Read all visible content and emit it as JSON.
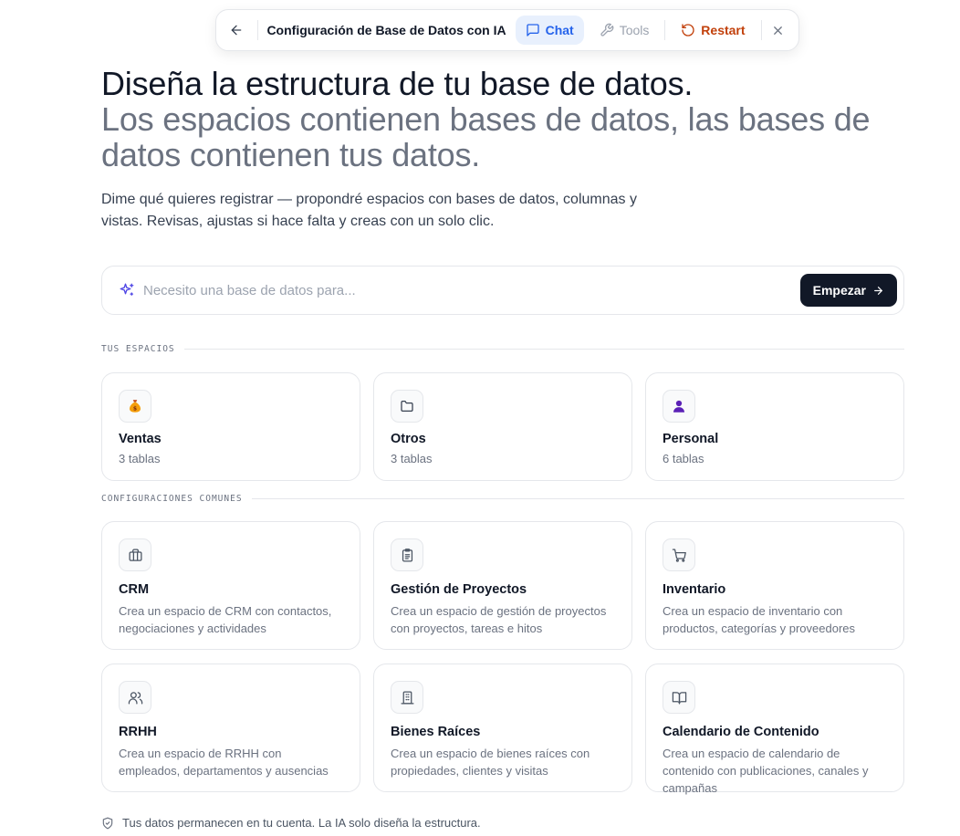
{
  "toolbar": {
    "title": "Configuración de Base de Datos con IA",
    "chat_label": "Chat",
    "tools_label": "Tools",
    "restart_label": "Restart"
  },
  "hero": {
    "title": "Diseña la estructura de tu base de datos.",
    "subtitle": "Los espacios contienen bases de datos, las bases de datos contienen tus datos.",
    "description": "Dime qué quieres registrar — propondré espacios con bases de datos, columnas y vistas. Revisas, ajustas si hace falta y creas con un solo clic."
  },
  "prompt": {
    "placeholder": "Necesito una base de datos para...",
    "value": "",
    "start_label": "Empezar"
  },
  "spaces": {
    "label": "TUS ESPACIOS",
    "items": [
      {
        "icon": "money-bag-icon",
        "title": "Ventas",
        "sub": "3 tablas"
      },
      {
        "icon": "folder-icon",
        "title": "Otros",
        "sub": "3 tablas"
      },
      {
        "icon": "person-icon",
        "title": "Personal",
        "sub": "6 tablas"
      }
    ]
  },
  "templates": {
    "label": "CONFIGURACIONES COMUNES",
    "items": [
      {
        "icon": "briefcase-icon",
        "title": "CRM",
        "desc": "Crea un espacio de CRM con contactos, negociaciones y actividades"
      },
      {
        "icon": "clipboard-icon",
        "title": "Gestión de Proyectos",
        "desc": "Crea un espacio de gestión de proyectos con proyectos, tareas e hitos"
      },
      {
        "icon": "cart-icon",
        "title": "Inventario",
        "desc": "Crea un espacio de inventario con productos, categorías y proveedores"
      },
      {
        "icon": "users-icon",
        "title": "RRHH",
        "desc": "Crea un espacio de RRHH con empleados, departamentos y ausencias"
      },
      {
        "icon": "building-icon",
        "title": "Bienes Raíces",
        "desc": "Crea un espacio de bienes raíces con propiedades, clientes y visitas"
      },
      {
        "icon": "book-icon",
        "title": "Calendario de Contenido",
        "desc": "Crea un espacio de calendario de contenido con publicaciones, canales y campañas"
      }
    ]
  },
  "footer": {
    "text": "Tus datos permanecen en tu cuenta. La IA solo diseña la estructura."
  },
  "colors": {
    "accent": "#2563eb",
    "restart": "#c2410c",
    "primary_button": "#111827",
    "sparkle": "#4f46e5"
  }
}
